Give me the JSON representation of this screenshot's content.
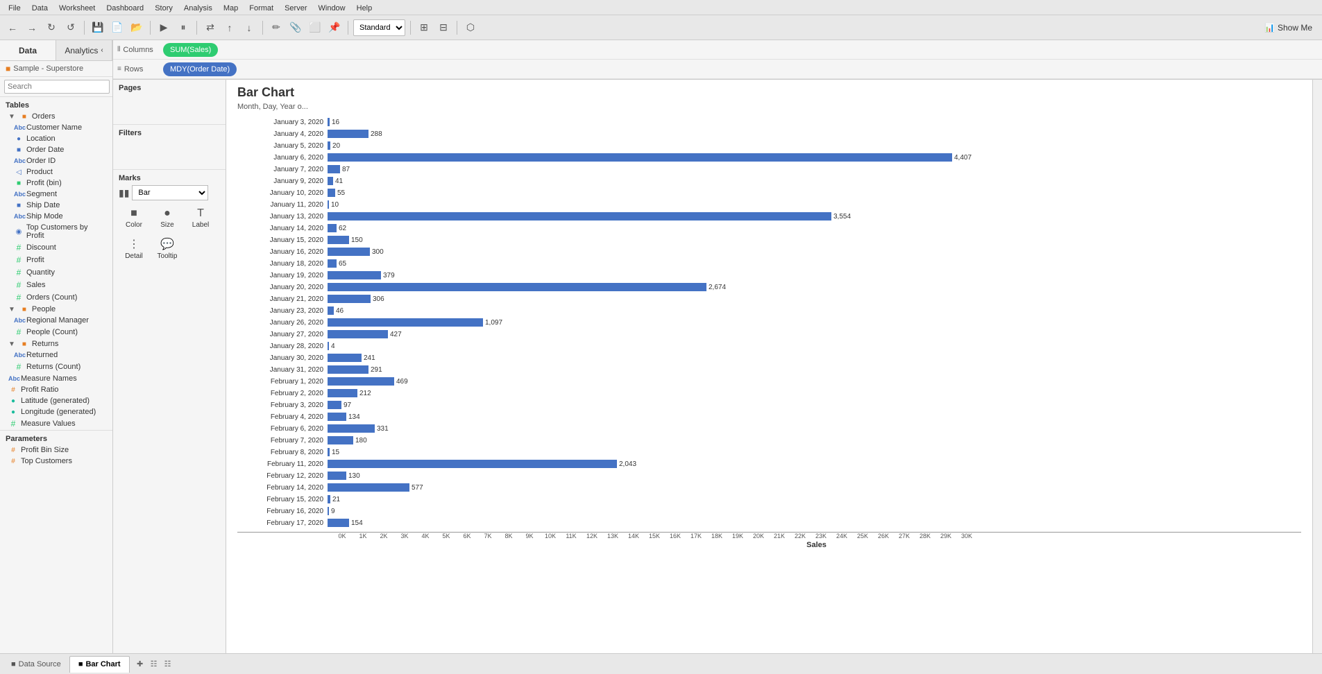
{
  "menubar": {
    "items": [
      "File",
      "Data",
      "Worksheet",
      "Dashboard",
      "Story",
      "Analysis",
      "Map",
      "Format",
      "Server",
      "Window",
      "Help"
    ]
  },
  "toolbar": {
    "show_me_label": "Show Me"
  },
  "left_panel": {
    "tabs": [
      {
        "label": "Data",
        "active": true
      },
      {
        "label": "Analytics",
        "active": false
      }
    ],
    "data_source": "Sample - Superstore",
    "search_placeholder": "Search",
    "tables_label": "Tables",
    "sections": [
      {
        "name": "Orders",
        "collapsed": false,
        "fields": [
          {
            "name": "Customer Name",
            "type": "abc",
            "indented": true
          },
          {
            "name": "Location",
            "type": "globe",
            "indented": true
          },
          {
            "name": "Order Date",
            "type": "calendar",
            "indented": true
          },
          {
            "name": "Order ID",
            "type": "abc",
            "indented": true
          },
          {
            "name": "Product",
            "type": "hierarchy",
            "indented": true
          },
          {
            "name": "Profit (bin)",
            "type": "hash-special",
            "indented": true
          },
          {
            "name": "Segment",
            "type": "abc",
            "indented": true
          },
          {
            "name": "Ship Date",
            "type": "calendar",
            "indented": true
          },
          {
            "name": "Ship Mode",
            "type": "abc",
            "indented": true
          },
          {
            "name": "Top Customers by Profit",
            "type": "calc-globe",
            "indented": true
          },
          {
            "name": "Discount",
            "type": "hash",
            "indented": true
          },
          {
            "name": "Profit",
            "type": "hash",
            "indented": true
          },
          {
            "name": "Quantity",
            "type": "hash",
            "indented": true
          },
          {
            "name": "Sales",
            "type": "hash",
            "indented": true
          },
          {
            "name": "Orders (Count)",
            "type": "hash",
            "indented": true
          }
        ]
      },
      {
        "name": "People",
        "collapsed": false,
        "fields": [
          {
            "name": "Regional Manager",
            "type": "abc",
            "indented": true
          },
          {
            "name": "People (Count)",
            "type": "hash",
            "indented": true
          }
        ]
      },
      {
        "name": "Returns",
        "collapsed": false,
        "fields": [
          {
            "name": "Returned",
            "type": "abc",
            "indented": true
          },
          {
            "name": "Returns (Count)",
            "type": "hash",
            "indented": true
          }
        ]
      }
    ],
    "extra_fields": [
      {
        "name": "Measure Names",
        "type": "abc"
      },
      {
        "name": "Profit Ratio",
        "type": "hash-calc"
      },
      {
        "name": "Latitude (generated)",
        "type": "globe-hash"
      },
      {
        "name": "Longitude (generated)",
        "type": "globe-hash"
      },
      {
        "name": "Measure Values",
        "type": "hash"
      }
    ],
    "parameters_label": "Parameters",
    "parameters": [
      {
        "name": "Profit Bin Size",
        "type": "hash"
      },
      {
        "name": "Top Customers",
        "type": "hash"
      }
    ]
  },
  "pages_label": "Pages",
  "filters_label": "Filters",
  "marks": {
    "label": "Marks",
    "type": "Bar",
    "buttons": [
      {
        "label": "Color",
        "icon": "⬛"
      },
      {
        "label": "Size",
        "icon": "●"
      },
      {
        "label": "Label",
        "icon": "T"
      },
      {
        "label": "Detail",
        "icon": "⋮"
      },
      {
        "label": "Tooltip",
        "icon": "💬"
      }
    ]
  },
  "shelves": {
    "columns_label": "Columns",
    "columns_icon": "|||",
    "columns_pill": "SUM(Sales)",
    "rows_label": "Rows",
    "rows_icon": "≡",
    "rows_pill": "MDY(Order Date)"
  },
  "chart": {
    "title": "Bar Chart",
    "subtitle": "Month, Day, Year o...",
    "x_axis_label": "Sales",
    "bars": [
      {
        "label": "January 3, 2020",
        "value": 16,
        "max": 4407
      },
      {
        "label": "January 4, 2020",
        "value": 288,
        "max": 4407
      },
      {
        "label": "January 5, 2020",
        "value": 20,
        "max": 4407
      },
      {
        "label": "January 6, 2020",
        "value": 4407,
        "max": 4407
      },
      {
        "label": "January 7, 2020",
        "value": 87,
        "max": 4407
      },
      {
        "label": "January 9, 2020",
        "value": 41,
        "max": 4407
      },
      {
        "label": "January 10, 2020",
        "value": 55,
        "max": 4407
      },
      {
        "label": "January 11, 2020",
        "value": 10,
        "max": 4407
      },
      {
        "label": "January 13, 2020",
        "value": 3554,
        "max": 4407
      },
      {
        "label": "January 14, 2020",
        "value": 62,
        "max": 4407
      },
      {
        "label": "January 15, 2020",
        "value": 150,
        "max": 4407
      },
      {
        "label": "January 16, 2020",
        "value": 300,
        "max": 4407
      },
      {
        "label": "January 18, 2020",
        "value": 65,
        "max": 4407
      },
      {
        "label": "January 19, 2020",
        "value": 379,
        "max": 4407
      },
      {
        "label": "January 20, 2020",
        "value": 2674,
        "max": 4407
      },
      {
        "label": "January 21, 2020",
        "value": 306,
        "max": 4407
      },
      {
        "label": "January 23, 2020",
        "value": 46,
        "max": 4407
      },
      {
        "label": "January 26, 2020",
        "value": 1097,
        "max": 4407
      },
      {
        "label": "January 27, 2020",
        "value": 427,
        "max": 4407
      },
      {
        "label": "January 28, 2020",
        "value": 4,
        "max": 4407
      },
      {
        "label": "January 30, 2020",
        "value": 241,
        "max": 4407
      },
      {
        "label": "January 31, 2020",
        "value": 291,
        "max": 4407
      },
      {
        "label": "February 1, 2020",
        "value": 469,
        "max": 4407
      },
      {
        "label": "February 2, 2020",
        "value": 212,
        "max": 4407
      },
      {
        "label": "February 3, 2020",
        "value": 97,
        "max": 4407
      },
      {
        "label": "February 4, 2020",
        "value": 134,
        "max": 4407
      },
      {
        "label": "February 6, 2020",
        "value": 331,
        "max": 4407
      },
      {
        "label": "February 7, 2020",
        "value": 180,
        "max": 4407
      },
      {
        "label": "February 8, 2020",
        "value": 15,
        "max": 4407
      },
      {
        "label": "February 11, 2020",
        "value": 2043,
        "max": 4407
      },
      {
        "label": "February 12, 2020",
        "value": 130,
        "max": 4407
      },
      {
        "label": "February 14, 2020",
        "value": 577,
        "max": 4407
      },
      {
        "label": "February 15, 2020",
        "value": 21,
        "max": 4407
      },
      {
        "label": "February 16, 2020",
        "value": 9,
        "max": 4407
      },
      {
        "label": "February 17, 2020",
        "value": 154,
        "max": 4407
      }
    ],
    "x_ticks": [
      "0K",
      "1K",
      "2K",
      "3K",
      "4K",
      "5K",
      "6K",
      "7K",
      "8K",
      "9K",
      "10K",
      "11K",
      "12K",
      "13K",
      "14K",
      "15K",
      "16K",
      "17K",
      "18K",
      "19K",
      "20K",
      "21K",
      "22K",
      "23K",
      "24K",
      "25K",
      "26K",
      "27K",
      "28K",
      "29K",
      "30K"
    ]
  },
  "bottom_bar": {
    "data_source_label": "Data Source",
    "sheet_label": "Bar Chart",
    "icons": [
      "⊞",
      "⊟",
      "⊠"
    ]
  }
}
